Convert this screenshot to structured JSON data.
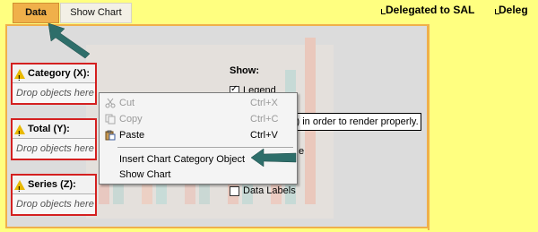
{
  "tabs": [
    {
      "label": "Data",
      "active": true
    },
    {
      "label": "Show Chart",
      "active": false
    }
  ],
  "header": {
    "delegated_full": "Delegated to SAL",
    "delegated_partial": "Deleg"
  },
  "drop_zones": [
    {
      "title": "Category (X):",
      "placeholder": "Drop objects here"
    },
    {
      "title": "Total (Y):",
      "placeholder": "Drop objects here"
    },
    {
      "title": "Series (Z):",
      "placeholder": "Drop objects here"
    }
  ],
  "warning_glyph": "!",
  "show": {
    "label": "Show:",
    "legend_label": "Legend",
    "legend_checked": true,
    "data_labels_label": "Data Labels",
    "data_labels_checked": false,
    "partial_text": "e"
  },
  "tooltip": {
    "text": "s) in order to render properly."
  },
  "context_menu": {
    "items": [
      {
        "label": "Cut",
        "shortcut": "Ctrl+X",
        "enabled": false,
        "icon": "scissors-icon"
      },
      {
        "label": "Copy",
        "shortcut": "Ctrl+C",
        "enabled": false,
        "icon": "copy-icon"
      },
      {
        "label": "Paste",
        "shortcut": "Ctrl+V",
        "enabled": true,
        "icon": "paste-icon"
      },
      {
        "label": "Insert Chart Category Object",
        "shortcut": "",
        "enabled": true,
        "icon": ""
      },
      {
        "label": "Show Chart",
        "shortcut": "",
        "enabled": true,
        "icon": ""
      }
    ]
  },
  "colors": {
    "background": "#ffff80",
    "tab_active": "#f0b04a",
    "drop_zone_border": "#d42020",
    "annotation_arrow": "#2e6e6a"
  }
}
